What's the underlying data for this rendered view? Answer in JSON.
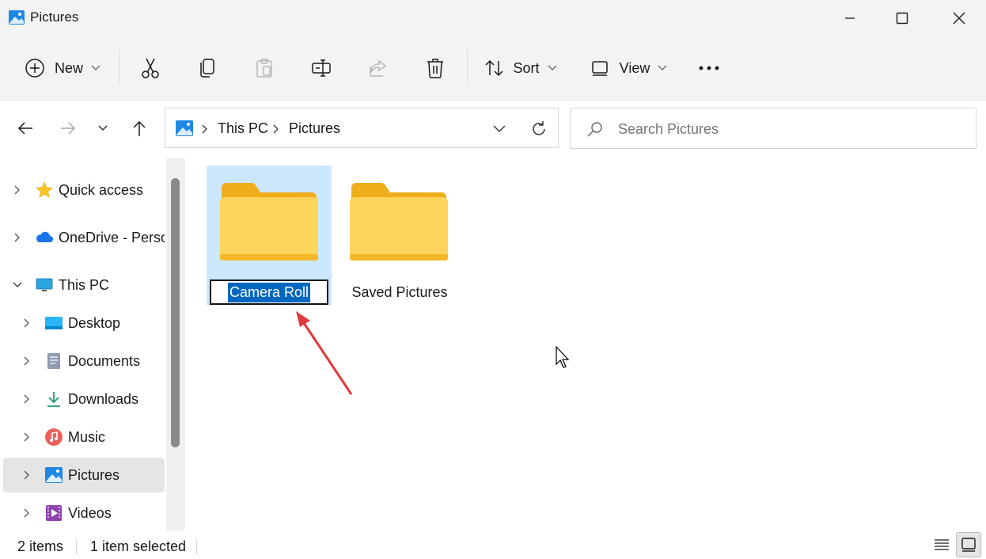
{
  "window": {
    "title": "Pictures",
    "min_icon": "minimize-icon",
    "max_icon": "maximize-icon",
    "close_icon": "close-icon"
  },
  "toolbar": {
    "new_label": "New",
    "sort_label": "Sort",
    "view_label": "View",
    "icons": [
      "plus-circle-icon",
      "cut-icon",
      "copy-icon",
      "paste-icon",
      "rename-icon",
      "share-icon",
      "delete-icon",
      "sort-icon",
      "view-icon",
      "more-icon"
    ]
  },
  "address": {
    "crumbs": [
      "This PC",
      "Pictures"
    ]
  },
  "search": {
    "placeholder": "Search Pictures"
  },
  "sidebar": {
    "items": [
      {
        "label": "Quick access",
        "icon": "star-icon"
      },
      {
        "label": "OneDrive - Perso",
        "icon": "cloud-icon"
      },
      {
        "label": "This PC",
        "icon": "monitor-icon"
      },
      {
        "label": "Desktop",
        "icon": "desktop-icon"
      },
      {
        "label": "Documents",
        "icon": "documents-icon"
      },
      {
        "label": "Downloads",
        "icon": "download-icon"
      },
      {
        "label": "Music",
        "icon": "music-icon"
      },
      {
        "label": "Pictures",
        "icon": "pictures-icon"
      },
      {
        "label": "Videos",
        "icon": "videos-icon"
      }
    ],
    "selected": "Pictures"
  },
  "content": {
    "folders": [
      {
        "name": "Camera Roll",
        "state": "renaming"
      },
      {
        "name": "Saved Pictures",
        "state": "normal"
      }
    ]
  },
  "status": {
    "item_count": "2 items",
    "selection": "1 item selected"
  },
  "colors": {
    "accent": "#0067c0",
    "selection_bg": "#cce8ff",
    "folder_yellow": "#f8c93c",
    "arrow_red": "#e0393e"
  }
}
